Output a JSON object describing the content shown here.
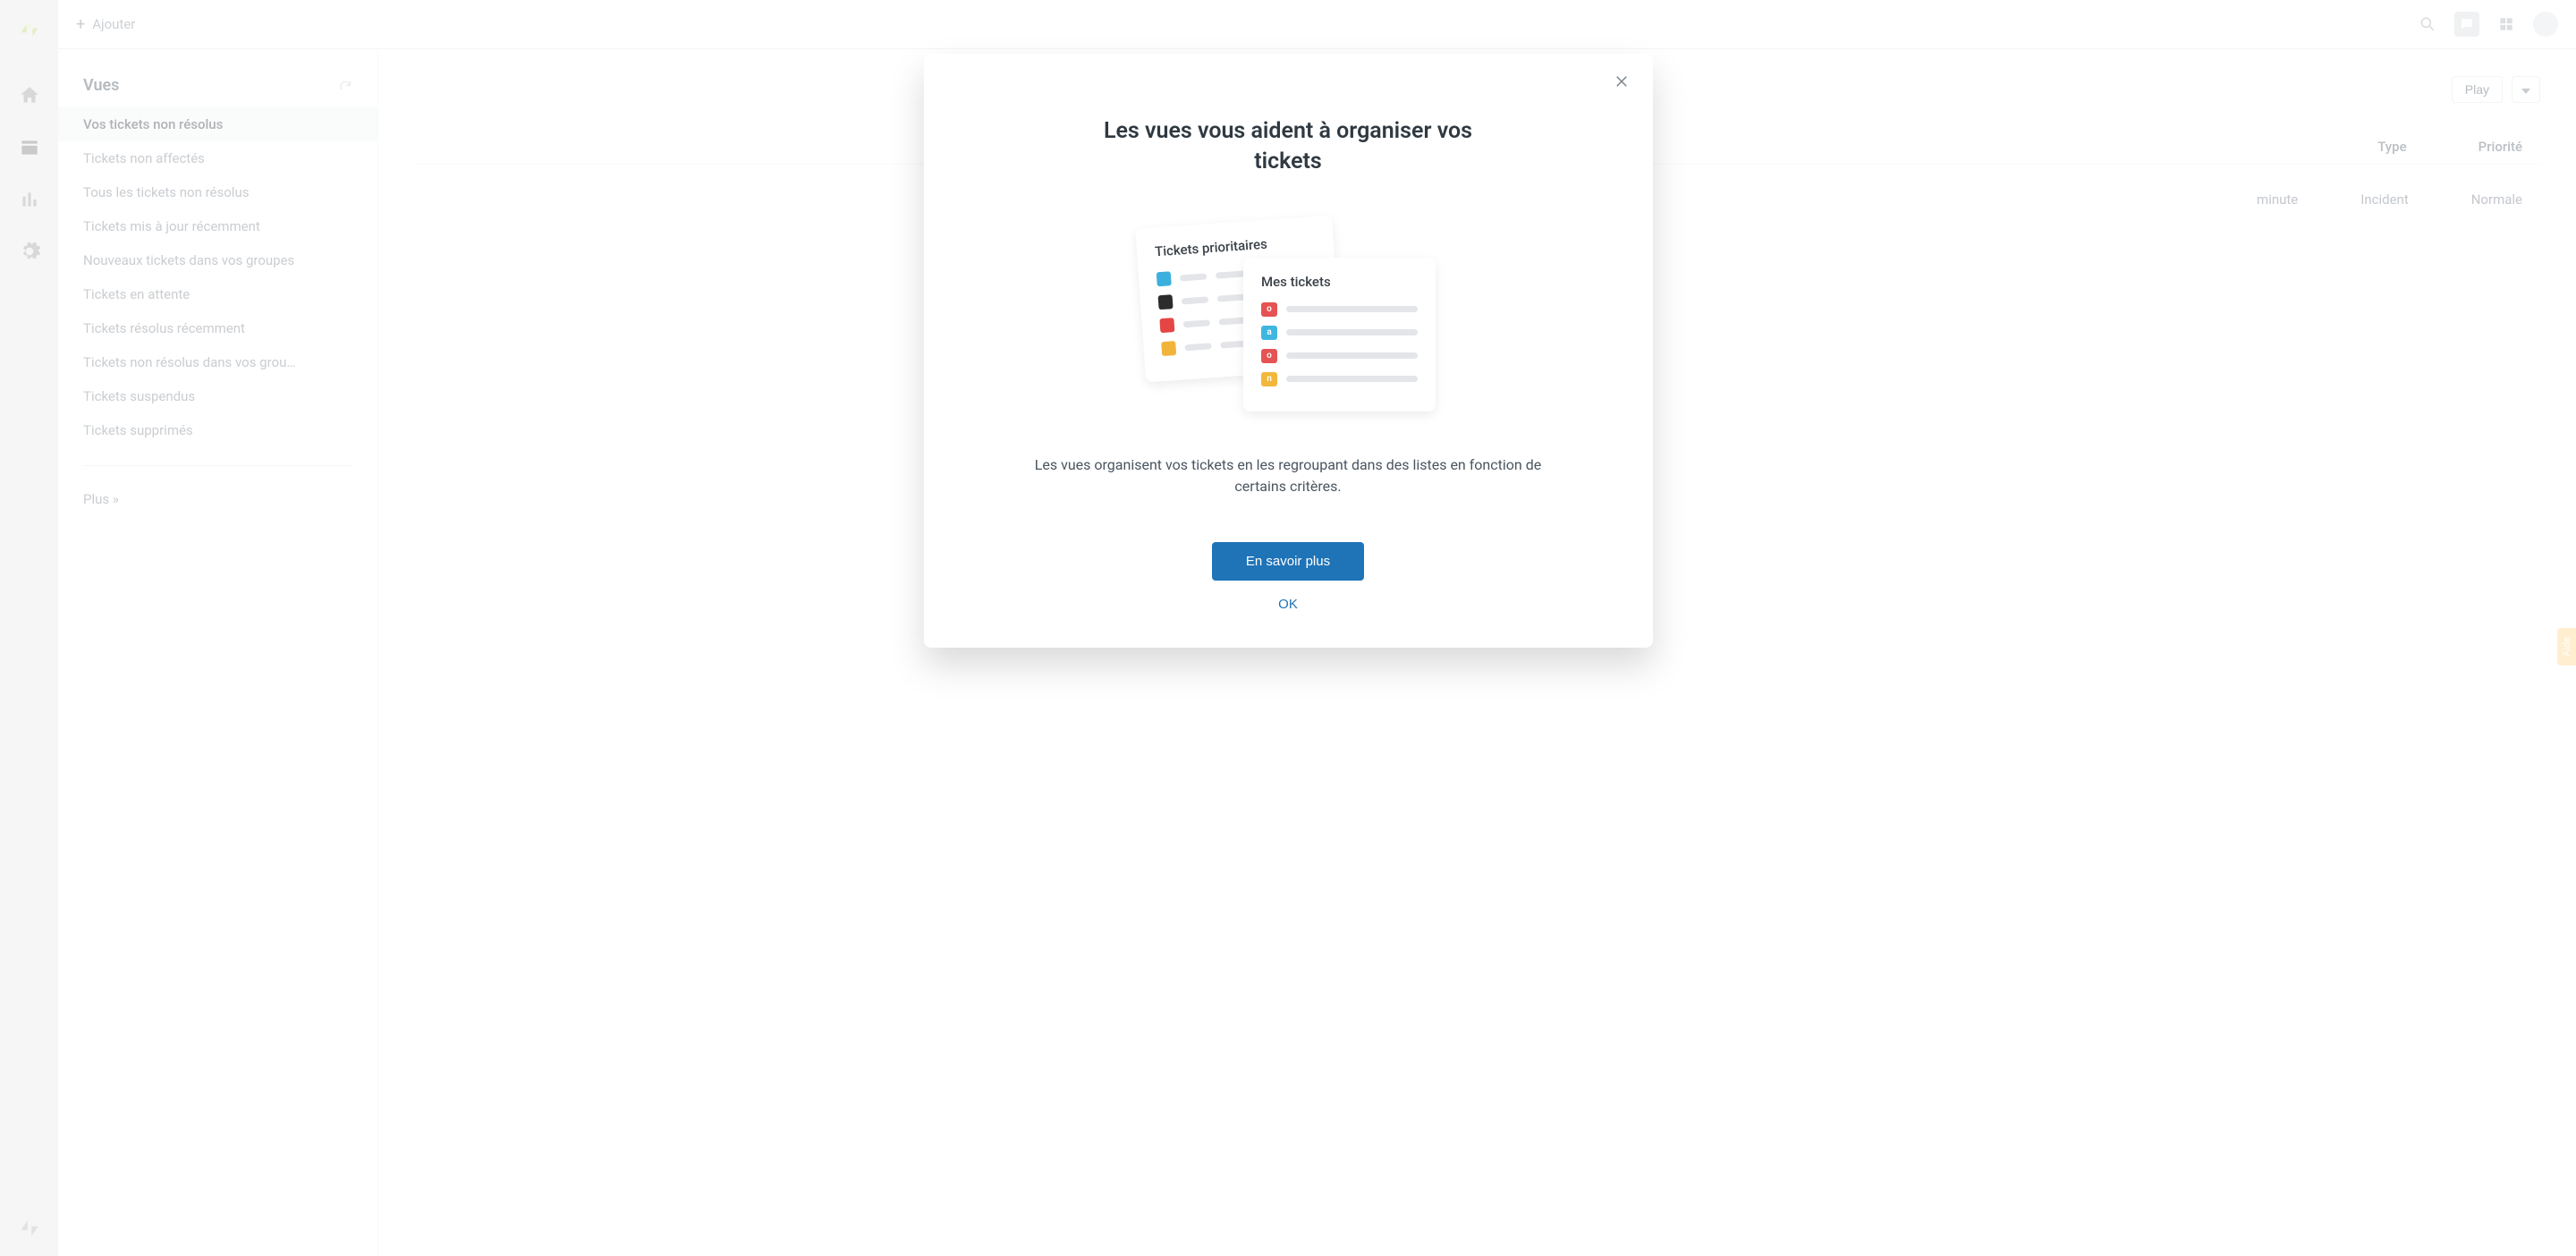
{
  "topbar": {
    "add_label": "Ajouter"
  },
  "sidebar": {
    "title": "Vues",
    "items": [
      "Vos tickets non résolus",
      "Tickets non affectés",
      "Tous les tickets non résolus",
      "Tickets mis à jour récemment",
      "Nouveaux tickets dans vos groupes",
      "Tickets en attente",
      "Tickets résolus récemment",
      "Tickets non résolus dans vos grou…",
      "Tickets suspendus",
      "Tickets supprimés"
    ],
    "more_label": "Plus »"
  },
  "content": {
    "play_label": "Play",
    "columns": {
      "type": "Type",
      "priority": "Priorité"
    },
    "row": {
      "time": "minute",
      "type": "Incident",
      "priority": "Normale"
    }
  },
  "modal": {
    "title": "Les vues vous aident à organiser vos tickets",
    "card_back_title": "Tickets prioritaires",
    "card_front_title": "Mes tickets",
    "front_badges": [
      "o",
      "a",
      "o",
      "n"
    ],
    "desc": "Les vues organisent vos tickets en les regroupant dans des listes en fonction de certains critères.",
    "primary_label": "En savoir plus",
    "ok_label": "OK"
  },
  "help_tab": "Aide",
  "colors": {
    "blue": "#3bb0df",
    "black": "#2c2c2c",
    "red": "#e64545",
    "yellow": "#f1b43a",
    "badge_red": "#e55353",
    "badge_blue": "#3fb6e0",
    "badge_yellow": "#f2b73b"
  }
}
